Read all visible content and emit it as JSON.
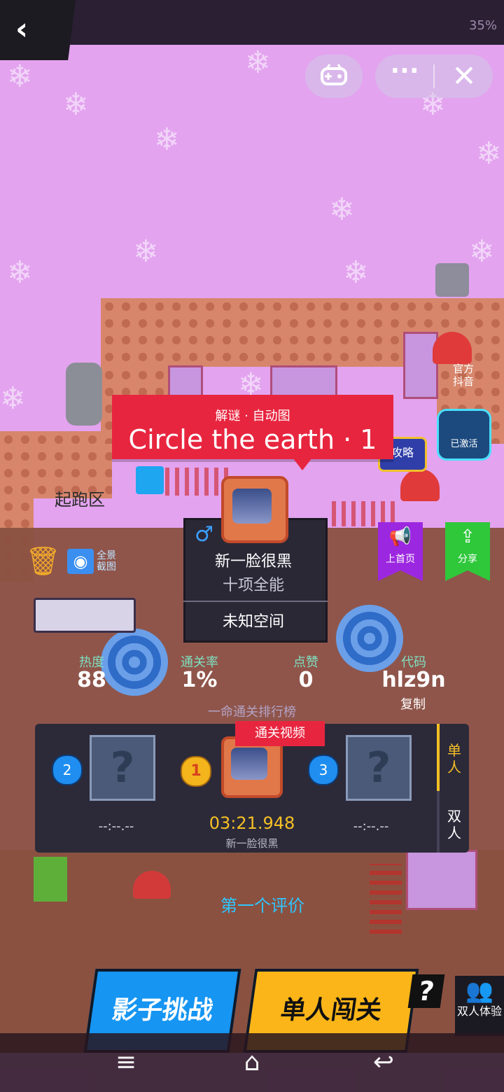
{
  "status": {
    "right_text": "35%"
  },
  "top_controls": {
    "gamepad_icon": "gamepad-icon",
    "more_icon": "more-icon",
    "close_icon": "close-icon"
  },
  "level": {
    "tag": "解谜 · 自动图",
    "title": "Circle the earth · 1"
  },
  "scene_labels": {
    "start_zone": "起跑区",
    "guide": "攻略",
    "official": "官方抖音",
    "activated": "已激活"
  },
  "creator": {
    "gender": "♂",
    "name": "新一脸很黑",
    "title": "十项全能",
    "world": "未知空间"
  },
  "tools": {
    "panorama_label": "全景截图"
  },
  "ribbons": {
    "home": "上首页",
    "share": "分享"
  },
  "stats": [
    {
      "label": "热度",
      "value": "88"
    },
    {
      "label": "通关率",
      "value": "1%"
    },
    {
      "label": "点赞",
      "value": "0"
    },
    {
      "label": "代码",
      "value": "hlz9n"
    }
  ],
  "copy_label": "复制",
  "leaderboard": {
    "title": "一命通关排行榜",
    "replay_label": "通关视频",
    "rank1": {
      "rank": "1",
      "time": "03:21.948",
      "name": "新一脸很黑"
    },
    "rank2": {
      "rank": "2",
      "time": "--:--.--"
    },
    "rank3": {
      "rank": "3",
      "time": "--:--.--"
    },
    "modes": {
      "single": "单人",
      "double": "双人"
    }
  },
  "first_review": "第一个评价",
  "buttons": {
    "shadow": "影子挑战",
    "single": "单人闯关",
    "help": "?",
    "duo": "双人体验"
  },
  "colors": {
    "accent_red": "#e8253f",
    "gold": "#f6c025",
    "blue": "#1695f2",
    "yellow": "#fbb518"
  }
}
